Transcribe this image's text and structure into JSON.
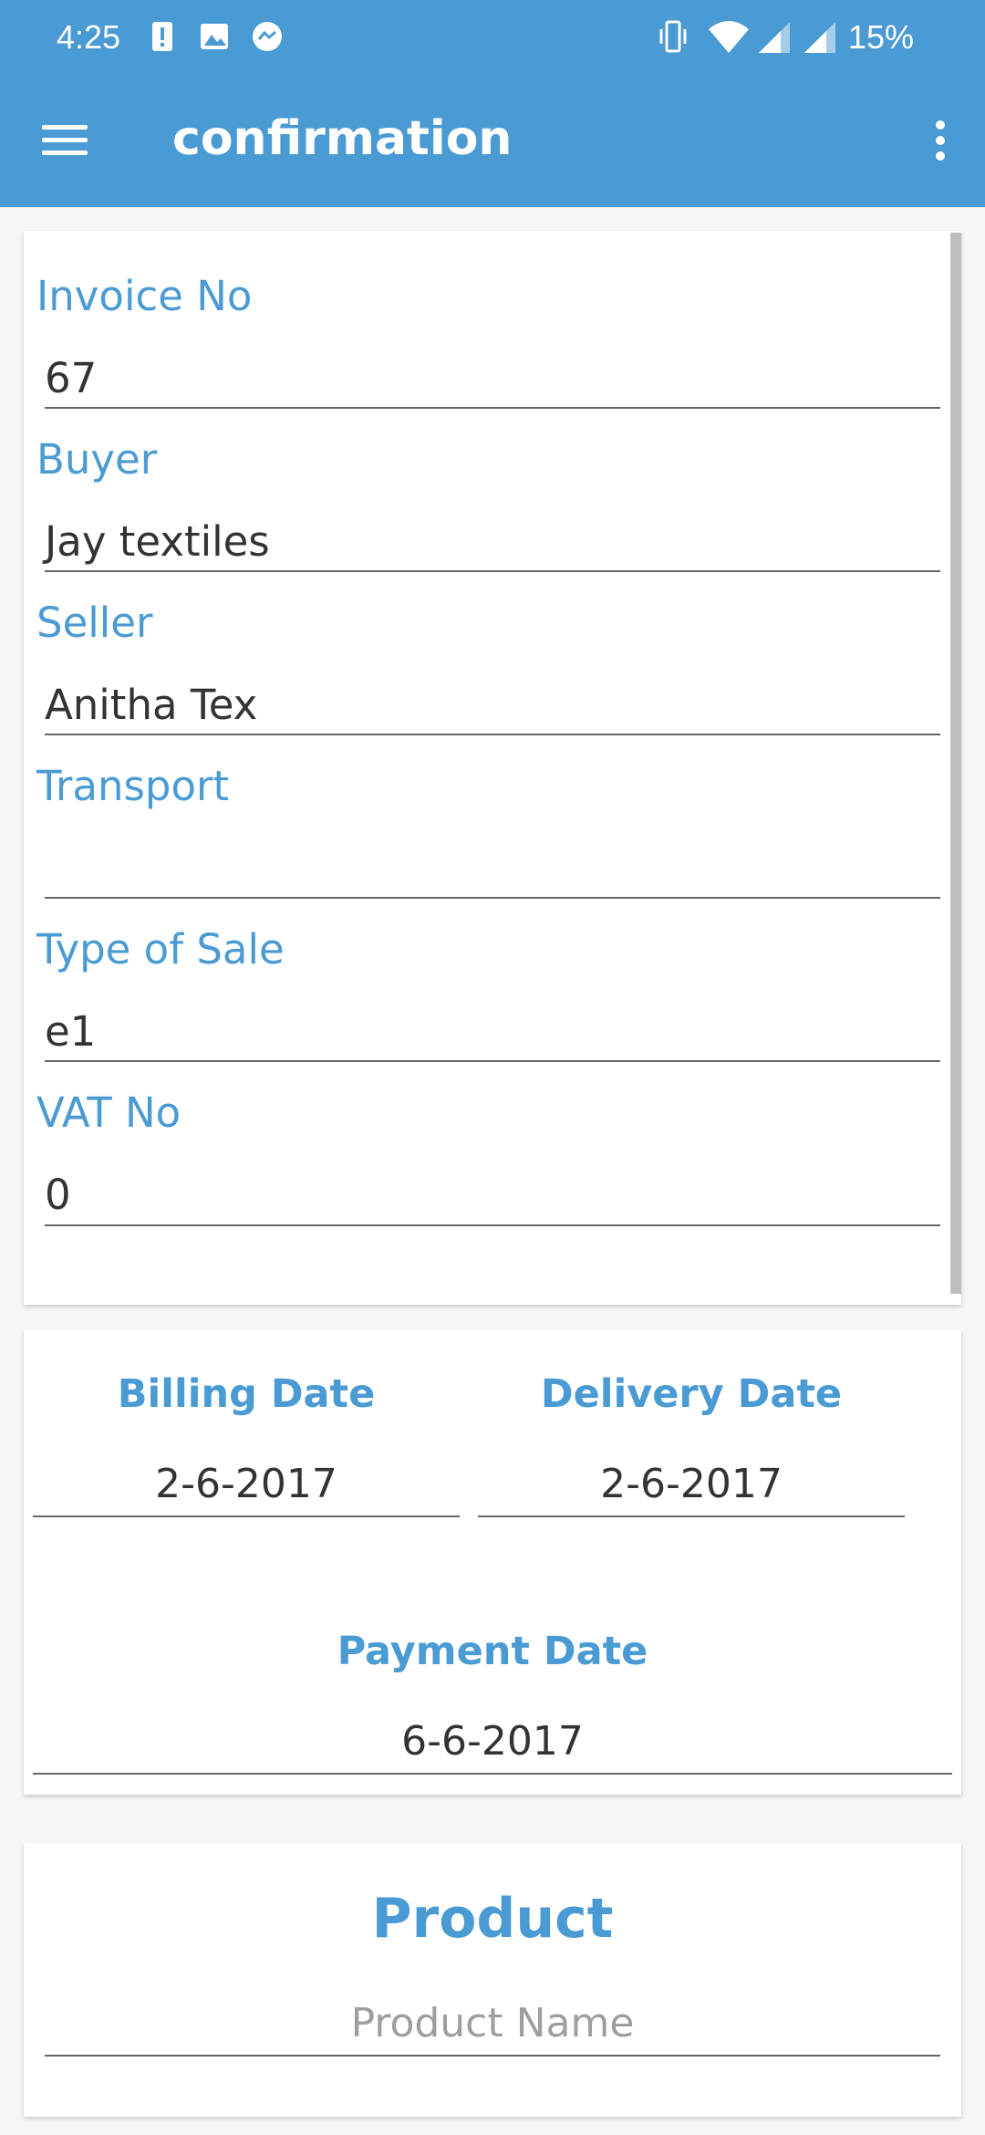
{
  "status_bar": {
    "time": "4:25",
    "battery": "15%",
    "icons": [
      "alert-icon",
      "image-icon",
      "messenger-icon",
      "vibrate-icon",
      "wifi-icon",
      "signal-icon",
      "signal-icon"
    ]
  },
  "app_bar": {
    "title": "confirmation",
    "accent_color": "#4a9ad4"
  },
  "form": {
    "fields": [
      {
        "label": "Invoice No",
        "value": "67"
      },
      {
        "label": "Buyer",
        "value": "Jay textiles"
      },
      {
        "label": "Seller",
        "value": "Anitha Tex"
      },
      {
        "label": "Transport",
        "value": ""
      },
      {
        "label": "Type of Sale",
        "value": "e1"
      },
      {
        "label": "VAT No",
        "value": "0"
      }
    ]
  },
  "dates": {
    "billing": {
      "label": "Billing Date",
      "value": "2-6-2017"
    },
    "delivery": {
      "label": "Delivery Date",
      "value": "2-6-2017"
    },
    "payment": {
      "label": "Payment Date",
      "value": "6-6-2017"
    }
  },
  "product": {
    "title": "Product",
    "name_placeholder": "Product Name"
  }
}
